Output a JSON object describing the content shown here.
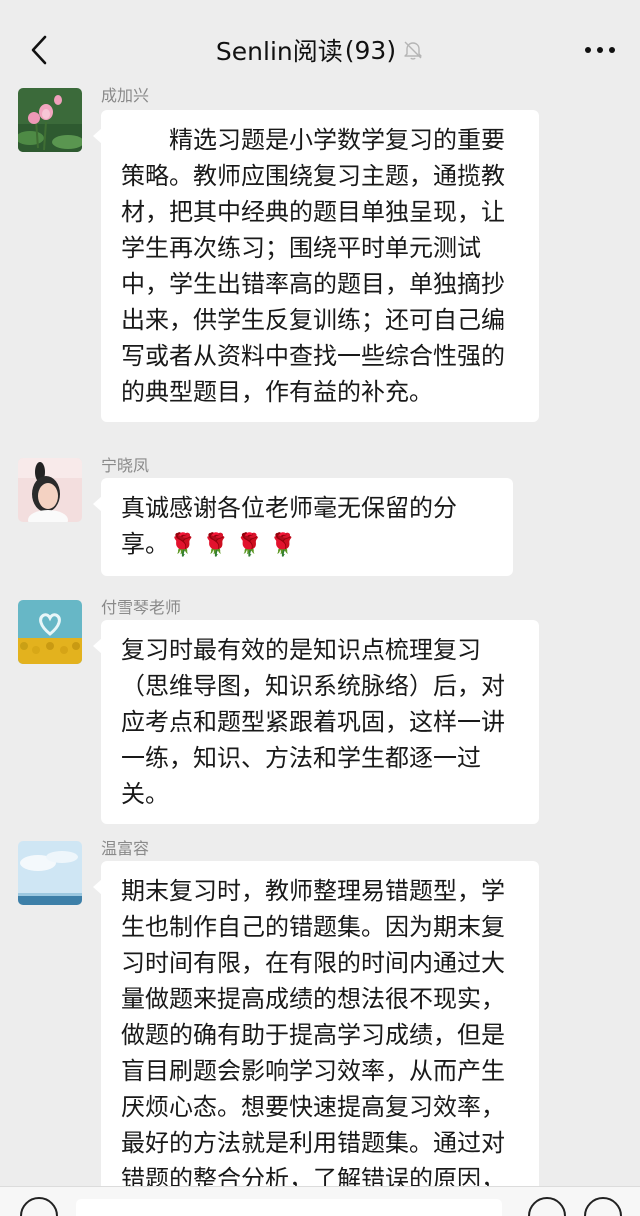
{
  "header": {
    "title": "Senlin阅读",
    "member_count": "(93)",
    "back_icon": "chevron-left-icon",
    "mute_icon": "bell-off-icon",
    "more_icon": "more-dots-icon"
  },
  "messages": [
    {
      "sender": "成加兴",
      "avatar": "lotus-avatar",
      "text": "精选习题是小学数学复习的重要策略。教师应围绕复习主题，通揽教材，把其中经典的题目单独呈现，让学生再次练习；围绕平时单元测试中，学生出错率高的题目，单独摘抄出来，供学生反复训练；还可自己编写或者从资料中查找一些综合性强的的典型题目，作有益的补充。"
    },
    {
      "sender": "宁晓凤",
      "avatar": "woman-avatar",
      "text": "真诚感谢各位老师毫无保留的分享。",
      "emoji": "🌹🌹🌹🌹"
    },
    {
      "sender": "付雪琴老师",
      "avatar": "sunflower-heart-avatar",
      "text": "复习时最有效的是知识点梳理复习（思维导图，知识系统脉络）后，对应考点和题型紧跟着巩固，这样一讲一练，知识、方法和学生都逐一过关。"
    },
    {
      "sender": "温富容",
      "avatar": "sky-avatar",
      "text": "期末复习时，教师整理易错题型，学生也制作自己的错题集。因为期末复习时间有限，在有限的时间内通过大量做题来提高成绩的想法很不现实，做题的确有助于提高学习成绩，但是盲目刷题会影响学习效率，从而产生厌烦心态。想要快速提高复习效率，最好的方法就是利用错题集。通过对错题的整合分析，了解错误的原因，掌握正确的"
    }
  ],
  "colors": {
    "background": "#ededed",
    "bubble": "#ffffff",
    "sender_name": "#8a8a8a",
    "emoji_red": "#d23a3a"
  }
}
